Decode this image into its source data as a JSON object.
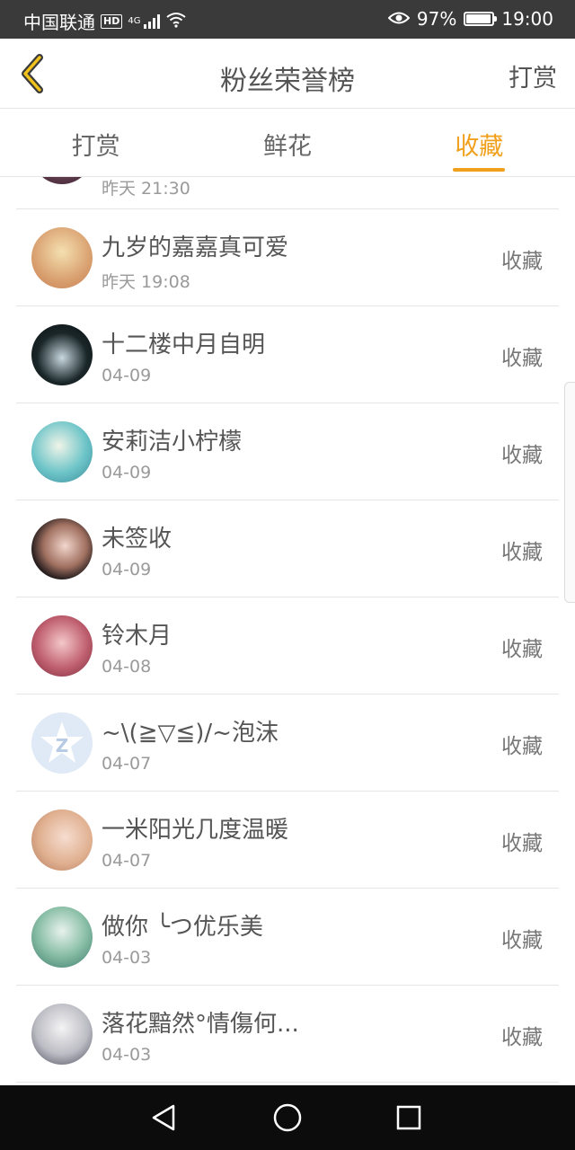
{
  "status_bar": {
    "carrier": "中国联通",
    "hd": "HD",
    "network": "4G",
    "battery_pct": "97%",
    "battery_level": 0.97,
    "time": "19:00"
  },
  "header": {
    "title": "粉丝荣誉榜",
    "right_action": "打赏"
  },
  "tabs": [
    {
      "label": "打赏",
      "active": false
    },
    {
      "label": "鲜花",
      "active": false
    },
    {
      "label": "收藏",
      "active": true
    }
  ],
  "partial_row": {
    "time": "昨天 21:30"
  },
  "rows": [
    {
      "name": "九岁的嘉嘉真可爱",
      "time": "昨天 19:08",
      "action": "收藏"
    },
    {
      "name": "十二楼中月自明",
      "time": "04-09",
      "action": "收藏"
    },
    {
      "name": "安莉洁小柠檬",
      "time": "04-09",
      "action": "收藏"
    },
    {
      "name": "未签收",
      "time": "04-09",
      "action": "收藏"
    },
    {
      "name": "铃木月",
      "time": "04-08",
      "action": "收藏"
    },
    {
      "name": "~\\(≧▽≦)/~泡沫",
      "time": "04-07",
      "action": "收藏"
    },
    {
      "name": "一米阳光几度温暖",
      "time": "04-07",
      "action": "收藏"
    },
    {
      "name": "做你 ╰つ优乐美",
      "time": "04-03",
      "action": "收藏"
    },
    {
      "name": "落花黯然°情傷何...",
      "time": "04-03",
      "action": "收藏"
    }
  ],
  "colors": {
    "accent": "#f1a01c",
    "status_bar": "#3a3a3a",
    "nav_bar": "#0c0c0c"
  }
}
